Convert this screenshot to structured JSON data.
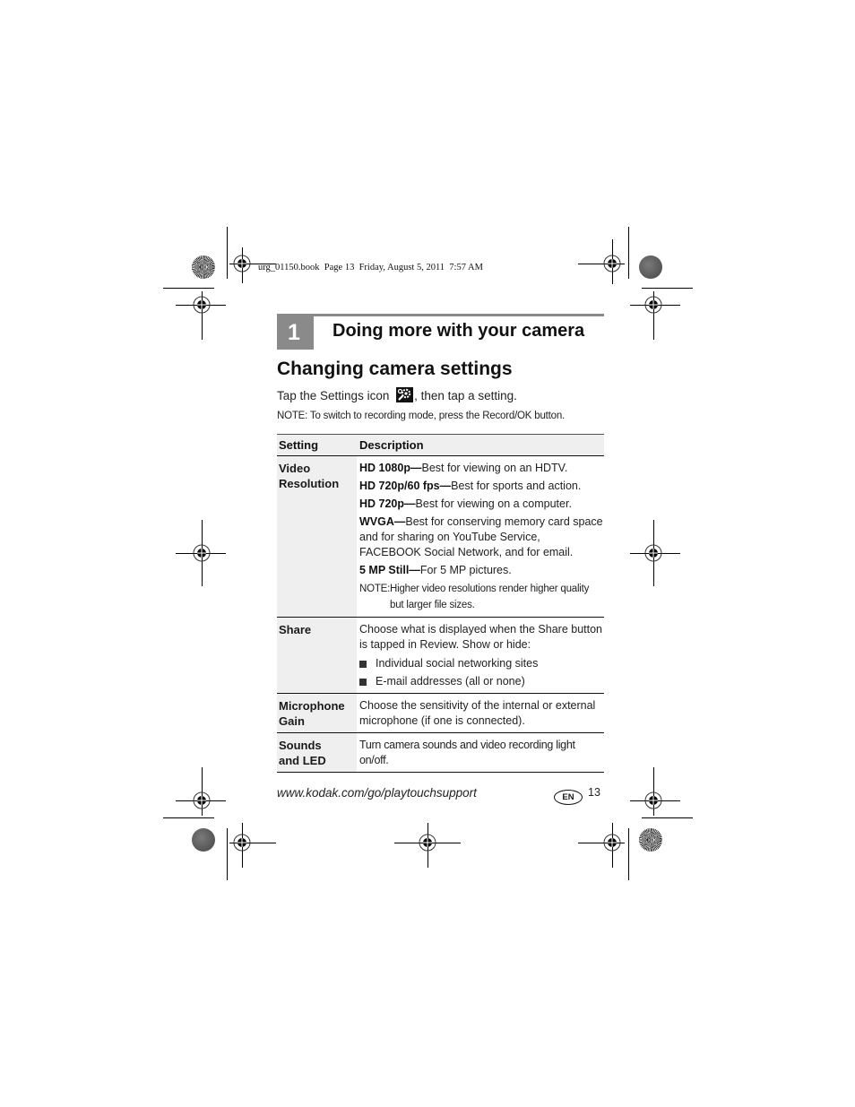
{
  "slug": "urg_01150.book  Page 13  Friday, August 5, 2011  7:57 AM",
  "chapter": {
    "number": "1",
    "title": "Doing more with your camera"
  },
  "section": {
    "title": "Changing camera settings",
    "intro_before": "Tap the Settings icon ",
    "intro_icon": "settings-icon",
    "intro_after": ", then tap a setting.",
    "note": "NOTE:  To switch to recording mode, press the Record/OK button."
  },
  "table": {
    "headers": [
      "Setting",
      "Description"
    ],
    "rows": [
      {
        "setting": "Video Resolution",
        "options": [
          {
            "name": "HD 1080p—",
            "text": "Best for viewing on an HDTV."
          },
          {
            "name": "HD 720p/60 fps—",
            "text": "Best for sports and action."
          },
          {
            "name": "HD 720p—",
            "text": "Best for viewing on a computer."
          },
          {
            "name": "WVGA—",
            "text": "Best for conserving memory card space and for sharing on YouTube Service, FACEBOOK Social Network, and for email."
          },
          {
            "name": "5 MP Still—",
            "text": "For 5 MP pictures."
          }
        ],
        "note_label": "NOTE:",
        "note_text": "Higher video resolutions render higher quality but larger file sizes."
      },
      {
        "setting": "Share",
        "description": "Choose what is displayed when the Share button is tapped in Review. Show or hide:",
        "bullets": [
          "Individual social networking sites",
          "E-mail addresses (all or none)"
        ]
      },
      {
        "setting": "Microphone Gain",
        "description": "Choose the sensitivity of the internal or external microphone (if one is connected)."
      },
      {
        "setting": "Sounds and LED",
        "description": "Turn camera sounds and video recording light on/off."
      }
    ]
  },
  "footer": {
    "url": "www.kodak.com/go/playtouchsupport",
    "language_badge": "EN",
    "page_number": "13"
  },
  "colors": {
    "chapter_gray": "#8a8a8a",
    "table_shade": "#efefef",
    "text": "#1a1a1a"
  }
}
